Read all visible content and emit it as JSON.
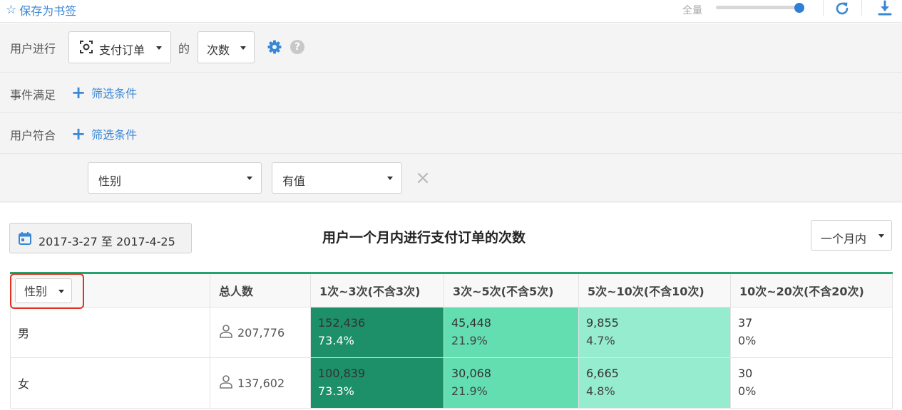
{
  "topbar": {
    "bookmark_label": "保存为书签",
    "zoom_label": "全量",
    "zoom_level": 0.94
  },
  "filters": {
    "row1_label": "用户进行",
    "event_select": "支付订单",
    "of_text": "的",
    "metric_select": "次数",
    "row2_label": "事件满足",
    "row2_add": "筛选条件",
    "row3_label": "用户符合",
    "row3_add": "筛选条件",
    "prop_select": "性别",
    "op_select": "有值"
  },
  "toolbar": {
    "date_range": "2017-3-27 至 2017-4-25",
    "chart_title": "用户一个月内进行支付订单的次数",
    "period_select": "一个月内"
  },
  "table": {
    "group_select": "性别",
    "headers": [
      "总人数",
      "1次~3次(不含3次)",
      "3次~5次(不含5次)",
      "5次~10次(不含10次)",
      "10次~20次(不含20次)"
    ],
    "rows": [
      {
        "label": "男",
        "total": "207,776",
        "cells": [
          {
            "num": "152,436",
            "pct": "73.4%"
          },
          {
            "num": "45,448",
            "pct": "21.9%"
          },
          {
            "num": "9,855",
            "pct": "4.7%"
          },
          {
            "num": "37",
            "pct": "0%"
          }
        ]
      },
      {
        "label": "女",
        "total": "137,602",
        "cells": [
          {
            "num": "100,839",
            "pct": "73.3%"
          },
          {
            "num": "30,068",
            "pct": "21.9%"
          },
          {
            "num": "6,665",
            "pct": "4.8%"
          },
          {
            "num": "30",
            "pct": "0%"
          }
        ]
      }
    ]
  },
  "icons": {
    "bookmark": "star-icon",
    "refresh": "refresh-icon",
    "download": "download-icon",
    "settings": "gear-icon",
    "help": "help-icon",
    "event": "event-icon",
    "date": "calendar-icon",
    "user": "user-icon",
    "remove": "close-icon"
  },
  "colors": {
    "accent": "#3a87d6",
    "header_rule": "#25a36f",
    "cell_high": "#1d8f69",
    "cell_mid": "#63deb1",
    "cell_low": "#95eccf",
    "highlight": "#e0321f"
  }
}
